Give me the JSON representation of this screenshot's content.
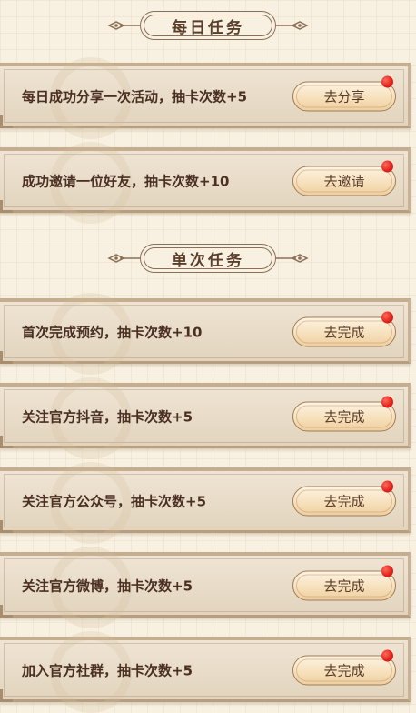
{
  "daily_section": {
    "title": "每日任务",
    "tasks": [
      {
        "text": "每日成功分享一次活动，抽卡次数+5",
        "button": "去分享"
      },
      {
        "text": "成功邀请一位好友，抽卡次数+10",
        "button": "去邀请"
      }
    ]
  },
  "once_section": {
    "title": "单次任务",
    "tasks": [
      {
        "text": "首次完成预约，抽卡次数+10",
        "button": "去完成"
      },
      {
        "text": "关注官方抖音，抽卡次数+5",
        "button": "去完成"
      },
      {
        "text": "关注官方公众号，抽卡次数+5",
        "button": "去完成"
      },
      {
        "text": "关注官方微博，抽卡次数+5",
        "button": "去完成"
      },
      {
        "text": "加入官方社群，抽卡次数+5",
        "button": "去完成"
      }
    ]
  },
  "colors": {
    "background": "#f8f1e1",
    "card": "#e8dcc8",
    "button": "#f6dfb9",
    "text": "#4a2f22",
    "notification_dot": "#e3251c"
  },
  "icons": {
    "header_ornament": "scroll-ornament-icon",
    "notification": "red-dot-icon"
  }
}
